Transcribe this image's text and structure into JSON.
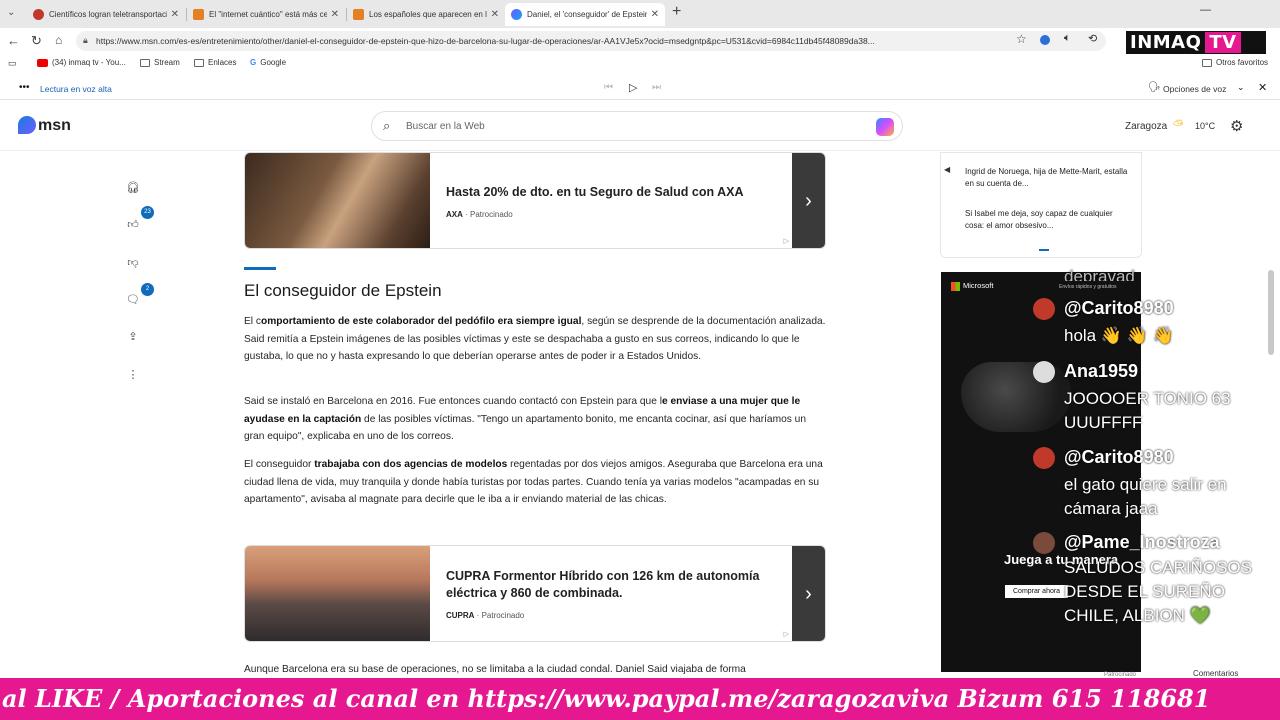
{
  "browser": {
    "tabs": [
      {
        "label": "Científicos logran teletransportaci",
        "icon": "news-favicon-icon",
        "color": "#c0392b"
      },
      {
        "label": "El \"internet cuántico\" está más cer",
        "icon": "news-favicon-icon",
        "color": "#e67e22"
      },
      {
        "label": "Los españoles que aparecen en la",
        "icon": "news-favicon-icon",
        "color": "#e67e22"
      },
      {
        "label": "Daniel, el 'conseguidor' de Epstein",
        "icon": "msn-favicon-icon",
        "color": "#6b5cff"
      }
    ],
    "new_tab": "+",
    "url": "https://www.msn.com/es-es/entretenimiento/other/daniel-el-conseguidor-de-epstein-que-hizo-de-barcelona-su-lugar-de-operaciones/ar-AA1VJe5x?ocid=msedgntp&pc=U531&cvid=6984c11db45f48089da38...",
    "bookmarks": [
      {
        "label": "(34) inmaq tv - You...",
        "icon": "youtube-icon"
      },
      {
        "label": "Stream",
        "icon": "folder-icon"
      },
      {
        "label": "Enlaces",
        "icon": "folder-icon"
      },
      {
        "label": "Google",
        "icon": "google-icon"
      }
    ],
    "other_favorites": "Otros favoritos",
    "read_aloud": "Lectura en voz alta",
    "voice_options": "Opciones de voz"
  },
  "msn": {
    "logo": "msn",
    "search_placeholder": "Buscar en la Web",
    "location": "Zaragoza",
    "temperature": "10°C",
    "likes": "23",
    "comments": "2"
  },
  "article": {
    "ad1": {
      "title": "Hasta 20% de dto. en tu Seguro de Salud con AXA",
      "brand": "AXA",
      "sponsored": "Patrocinado"
    },
    "heading": "El conseguidor de Epstein",
    "p1a": "El c",
    "p1b": "omportamiento de este colaborador del pedófilo era siempre igual",
    "p1c": ", según se desprende de la documentación analizada. Said remitía a Epstein imágenes de las posibles víctimas y este se despachaba a gusto en sus correos, indicando lo que le gustaba, lo que no y hasta expresando lo que deberían operarse antes de poder ir a Estados Unidos.",
    "p2a": "Said se instaló en Barcelona en 2016. Fue entonces cuando contactó con Epstein para que l",
    "p2b": "e enviase a una mujer que le ayudase en la captación",
    "p2c": " de las posibles víctimas. \"Tengo un apartamento bonito, me encanta cocinar, así que haríamos un gran equipo\", explicaba en uno de los correos.",
    "p3a": "El conseguidor ",
    "p3b": "trabajaba con dos agencias de modelos",
    "p3c": " regentadas por dos viejos amigos. Aseguraba que Barcelona era una ciudad llena de vida, muy tranquila y donde había turistas por todas partes. Cuando tenía ya varias modelos \"acampadas en su apartamento\", avisaba al magnate para decirle que le iba a ir enviando material de las chicas.",
    "ad2": {
      "title": "CUPRA Formentor Híbrido con 126 km de autonomía eléctrica y 860 de combinada.",
      "brand": "CUPRA",
      "sponsored": "Patrocinado"
    },
    "p4": "Aunque Barcelona era su base de operaciones, no se limitaba a la ciudad condal. Daniel Said viajaba de forma"
  },
  "right": {
    "card1": "Ingrid de Noruega, hija de Mette-Marit, estalla en su cuenta de...",
    "card2": "Si Isabel me deja, soy capaz de cualquier cosa: el amor obsesivo...",
    "promo_brand": "Microsoft",
    "promo_sub": "Envíos rápidos y gratuitos",
    "promo_title": "Juega a tu manera",
    "promo_cta": "Comprar ahora",
    "sponsored": "Patrocinado",
    "comments_label": "Comentarios"
  },
  "chat": {
    "partial": "depravad",
    "messages": [
      {
        "user": "@Carito8980",
        "text": "hola 👋 👋 👋"
      },
      {
        "user": "Ana1959",
        "text": "JOOOOER TONIO 63 UUUFFFF"
      },
      {
        "user": "@Carito8980",
        "text": "el gato quiere salir en cámara jaaa"
      },
      {
        "user": "@Pame_Inostroza",
        "text": "SALUDOS CARIÑOSOS DESDE EL SUREÑO CHILE, ALBION 💚"
      }
    ]
  },
  "overlay": {
    "logo_main": "INMAQ",
    "logo_tv": "TV",
    "ticker": "al LIKE / Aportaciones al canal en https://www.paypal.me/zaragozaviva Bizum 615 118681"
  }
}
